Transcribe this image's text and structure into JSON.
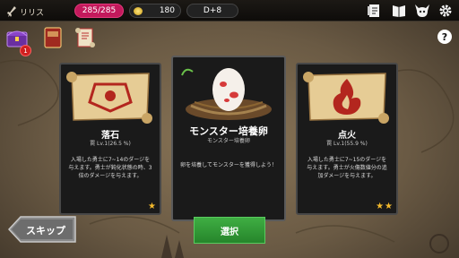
{
  "player": {
    "name": "リリス"
  },
  "stats": {
    "hp": "285/285",
    "gold": "180",
    "floor": "D+8"
  },
  "inventory": {
    "badge_count": "1"
  },
  "help_label": "?",
  "cards": [
    {
      "title": "落石",
      "subtitle": "罠 Lv.1(26.5 %)",
      "description": "入場した勇士に7~14のダージを与えます。勇士が鈍化状態の時、3倍のダメージを与えます。",
      "stars": 1
    },
    {
      "title": "モンスター培養卵",
      "subtitle": "モンスター培養卵",
      "description": "卵を培養してモンスターを獲得しよう！",
      "stars": 0
    },
    {
      "title": "点火",
      "subtitle": "罠 Lv.1(55.9 %)",
      "description": "入場した勇士に7~15のダージを与えます。勇士が火傷数値分の追加ダメージを与えます。",
      "stars": 2
    }
  ],
  "buttons": {
    "skip": "スキップ",
    "select": "選択"
  },
  "colors": {
    "hp": "#c3195c",
    "select": "#3fae43",
    "star": "#f3b92c"
  },
  "icons": {
    "player": "sword-icon",
    "gold": "coin-icon",
    "top_right": [
      "quest-card-icon",
      "book-icon",
      "demon-head-icon",
      "gear-icon"
    ],
    "inventory": [
      "chest-icon",
      "spellbook-icon",
      "scroll-icon"
    ]
  }
}
